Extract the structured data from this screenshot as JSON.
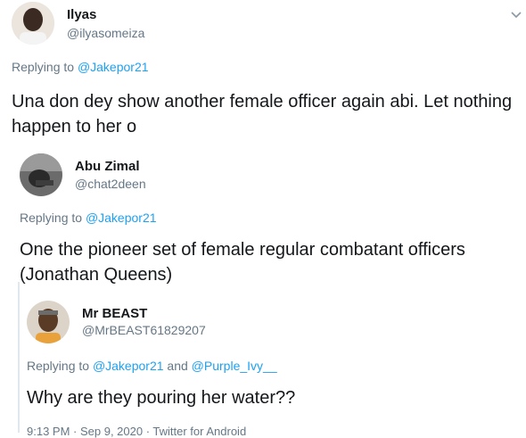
{
  "tweets": [
    {
      "name": "Ilyas",
      "handle": "@ilyasomeiza",
      "replying_prefix": "Replying to ",
      "mentions": [
        "@Jakepor21"
      ],
      "joiner": "",
      "text": "Una don dey show another female officer again abi. Let nothing happen to her o"
    },
    {
      "name": "Abu Zimal",
      "handle": "@chat2deen",
      "replying_prefix": "Replying to ",
      "mentions": [
        "@Jakepor21"
      ],
      "joiner": "",
      "text": "One the pioneer set of female regular combatant officers (Jonathan Queens)"
    },
    {
      "name": "Mr BEAST",
      "handle": "@MrBEAST61829207",
      "replying_prefix": "Replying to ",
      "mentions": [
        "@Jakepor21",
        "@Purple_Ivy__"
      ],
      "joiner": " and ",
      "text": "Why are they pouring her water??"
    }
  ],
  "footer_meta": "9:13 PM · Sep 9, 2020 · Twitter for Android",
  "icons": {
    "more": "chevron-down-icon"
  },
  "colors": {
    "link": "#1da1f2",
    "secondary": "#657786",
    "text": "#14171a"
  }
}
